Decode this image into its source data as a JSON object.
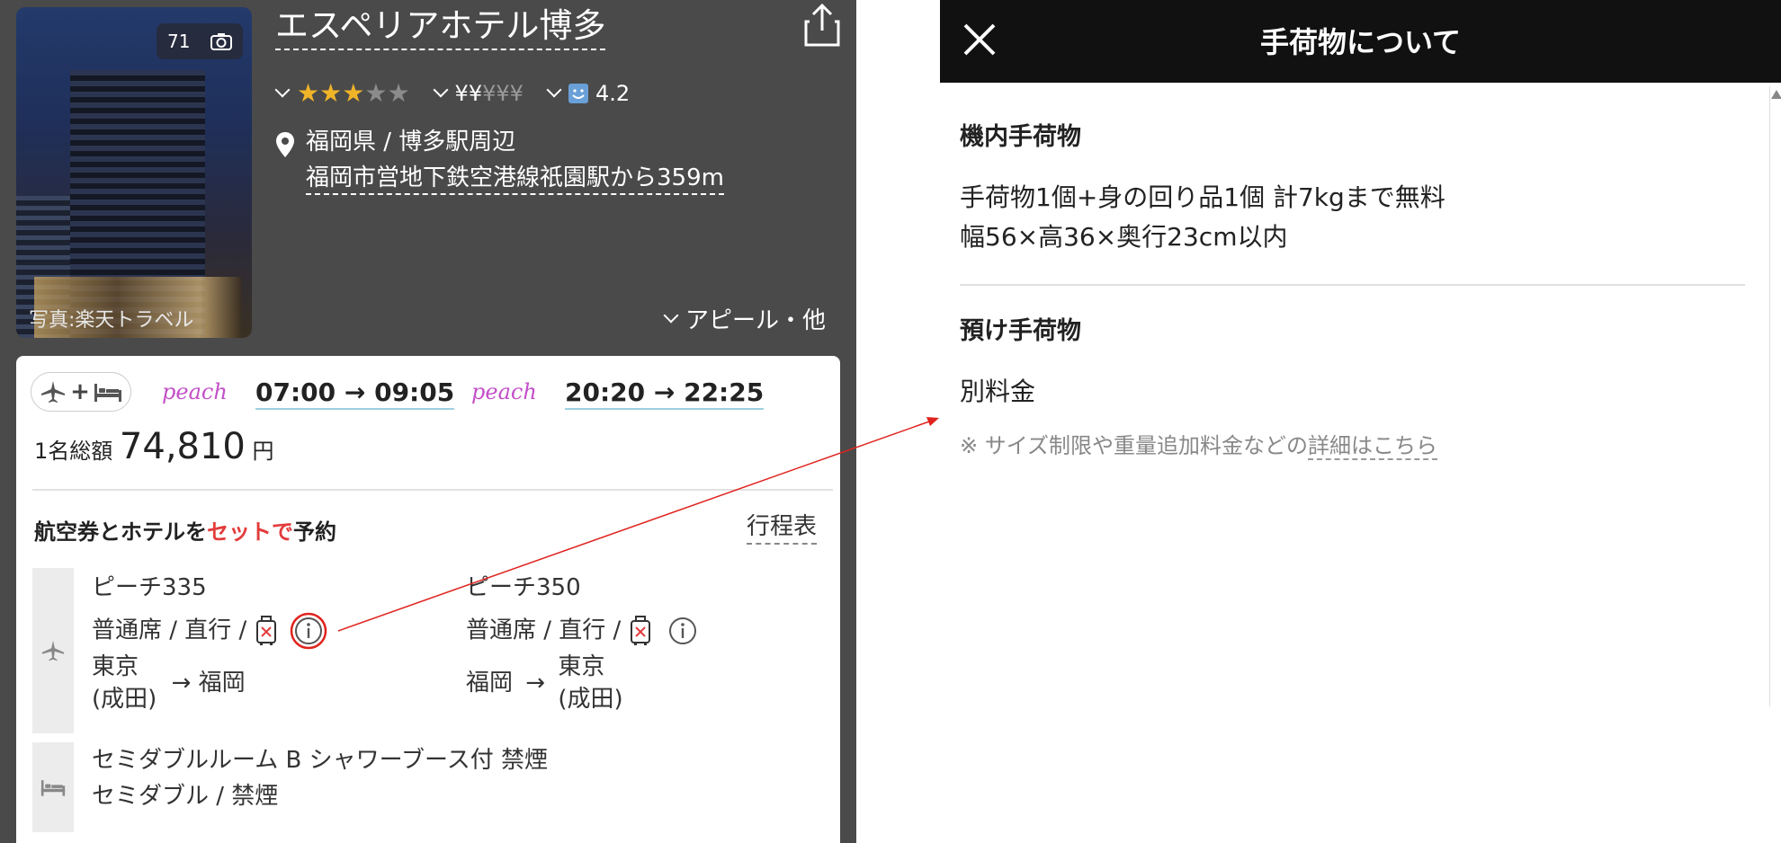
{
  "hotel": {
    "name": "エスペリアホテル博多",
    "photo_count": "71",
    "photo_credit": "写真:楽天トラベル",
    "stars": {
      "filled": 3,
      "total": 5
    },
    "price_level": {
      "filled": 2,
      "total": 5,
      "symbol": "¥"
    },
    "review_score": "4.2",
    "location_area": "福岡県 / 博多駅周辺",
    "location_access": "福岡市営地下鉄空港線祇園駅から359m",
    "appeal_label": "アピール・他"
  },
  "card": {
    "mode_pill": "+",
    "airline_logo": "peach",
    "outbound_time": "07:00 → 09:05",
    "return_time": "20:20 → 22:25",
    "price_prefix": "1名総額",
    "price_value": "74,810",
    "price_unit": "円",
    "set_title_a": "航空券とホテルを",
    "set_title_b": "セットで",
    "set_title_c": "予約",
    "itinerary_link": "行程表",
    "outbound": {
      "flight": "ピーチ335",
      "seat": "普通席 / 直行 /",
      "from": "東京",
      "from_sub": "(成田)",
      "arrow": "→",
      "to": "福岡"
    },
    "return": {
      "flight": "ピーチ350",
      "seat": "普通席 / 直行 /",
      "from": "福岡",
      "arrow": "→",
      "to": "東京",
      "to_sub": "(成田)"
    },
    "room_name": "セミダブルルーム B シャワーブース付 禁煙",
    "room_detail": "セミダブル / 禁煙"
  },
  "modal": {
    "title": "手荷物について",
    "cabin_title": "機内手荷物",
    "cabin_line1": "手荷物1個+身の回り品1個 計7kgまで無料",
    "cabin_line2": "幅56×高36×奥行23cm以内",
    "checked_title": "預け手荷物",
    "checked_body": "別料金",
    "note_prefix": "※ サイズ制限や重量追加料金などの",
    "note_link": "詳細はこちら"
  },
  "colors": {
    "left_bg": "#4a4a4a",
    "accent_red": "#e33b3b",
    "peach_purple": "#c34fc9",
    "star": "#f0b429",
    "modal_header": "#111111"
  }
}
